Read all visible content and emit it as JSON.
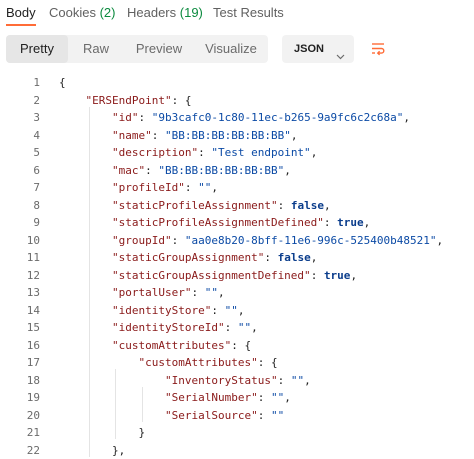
{
  "tabs": [
    {
      "label": "Body",
      "count": ""
    },
    {
      "label": "Cookies",
      "count": "(2)"
    },
    {
      "label": "Headers",
      "count": "(19)"
    },
    {
      "label": "Test Results",
      "count": ""
    }
  ],
  "toolbar": {
    "views": [
      "Pretty",
      "Raw",
      "Preview",
      "Visualize"
    ],
    "active_view": "Pretty",
    "format": "JSON",
    "icons": {
      "chevron": "chevron-down-icon",
      "wrap": "wrap-lines-icon"
    },
    "accent_color": "#ff6c37"
  },
  "code": {
    "colors": {
      "key": "#8a1a1a",
      "string": "#0b4aa5",
      "bool": "#0b3d8c",
      "line_number": "#6b6b6b"
    },
    "lines": [
      {
        "n": "1",
        "indent": 0,
        "tokens": [
          [
            "p",
            "{"
          ]
        ]
      },
      {
        "n": "2",
        "indent": 1,
        "tokens": [
          [
            "k",
            "\"ERSEndPoint\""
          ],
          [
            "p",
            ": {"
          ]
        ]
      },
      {
        "n": "3",
        "indent": 2,
        "tokens": [
          [
            "k",
            "\"id\""
          ],
          [
            "p",
            ": "
          ],
          [
            "s",
            "\"9b3cafc0-1c80-11ec-b265-9a9fc6c2c68a\""
          ],
          [
            "p",
            ","
          ]
        ]
      },
      {
        "n": "4",
        "indent": 2,
        "tokens": [
          [
            "k",
            "\"name\""
          ],
          [
            "p",
            ": "
          ],
          [
            "s",
            "\"BB:BB:BB:BB:BB:BB\""
          ],
          [
            "p",
            ","
          ]
        ]
      },
      {
        "n": "5",
        "indent": 2,
        "tokens": [
          [
            "k",
            "\"description\""
          ],
          [
            "p",
            ": "
          ],
          [
            "s",
            "\"Test endpoint\""
          ],
          [
            "p",
            ","
          ]
        ]
      },
      {
        "n": "6",
        "indent": 2,
        "tokens": [
          [
            "k",
            "\"mac\""
          ],
          [
            "p",
            ": "
          ],
          [
            "s",
            "\"BB:BB:BB:BB:BB:BB\""
          ],
          [
            "p",
            ","
          ]
        ]
      },
      {
        "n": "7",
        "indent": 2,
        "tokens": [
          [
            "k",
            "\"profileId\""
          ],
          [
            "p",
            ": "
          ],
          [
            "s",
            "\"\""
          ],
          [
            "p",
            ","
          ]
        ]
      },
      {
        "n": "8",
        "indent": 2,
        "tokens": [
          [
            "k",
            "\"staticProfileAssignment\""
          ],
          [
            "p",
            ": "
          ],
          [
            "b",
            "false"
          ],
          [
            "p",
            ","
          ]
        ]
      },
      {
        "n": "9",
        "indent": 2,
        "tokens": [
          [
            "k",
            "\"staticProfileAssignmentDefined\""
          ],
          [
            "p",
            ": "
          ],
          [
            "b",
            "true"
          ],
          [
            "p",
            ","
          ]
        ]
      },
      {
        "n": "10",
        "indent": 2,
        "tokens": [
          [
            "k",
            "\"groupId\""
          ],
          [
            "p",
            ": "
          ],
          [
            "s",
            "\"aa0e8b20-8bff-11e6-996c-525400b48521\""
          ],
          [
            "p",
            ","
          ]
        ]
      },
      {
        "n": "11",
        "indent": 2,
        "tokens": [
          [
            "k",
            "\"staticGroupAssignment\""
          ],
          [
            "p",
            ": "
          ],
          [
            "b",
            "false"
          ],
          [
            "p",
            ","
          ]
        ]
      },
      {
        "n": "12",
        "indent": 2,
        "tokens": [
          [
            "k",
            "\"staticGroupAssignmentDefined\""
          ],
          [
            "p",
            ": "
          ],
          [
            "b",
            "true"
          ],
          [
            "p",
            ","
          ]
        ]
      },
      {
        "n": "13",
        "indent": 2,
        "tokens": [
          [
            "k",
            "\"portalUser\""
          ],
          [
            "p",
            ": "
          ],
          [
            "s",
            "\"\""
          ],
          [
            "p",
            ","
          ]
        ]
      },
      {
        "n": "14",
        "indent": 2,
        "tokens": [
          [
            "k",
            "\"identityStore\""
          ],
          [
            "p",
            ": "
          ],
          [
            "s",
            "\"\""
          ],
          [
            "p",
            ","
          ]
        ]
      },
      {
        "n": "15",
        "indent": 2,
        "tokens": [
          [
            "k",
            "\"identityStoreId\""
          ],
          [
            "p",
            ": "
          ],
          [
            "s",
            "\"\""
          ],
          [
            "p",
            ","
          ]
        ]
      },
      {
        "n": "16",
        "indent": 2,
        "tokens": [
          [
            "k",
            "\"customAttributes\""
          ],
          [
            "p",
            ": {"
          ]
        ]
      },
      {
        "n": "17",
        "indent": 3,
        "tokens": [
          [
            "k",
            "\"customAttributes\""
          ],
          [
            "p",
            ": {"
          ]
        ]
      },
      {
        "n": "18",
        "indent": 4,
        "tokens": [
          [
            "k",
            "\"InventoryStatus\""
          ],
          [
            "p",
            ": "
          ],
          [
            "s",
            "\"\""
          ],
          [
            "p",
            ","
          ]
        ]
      },
      {
        "n": "19",
        "indent": 4,
        "tokens": [
          [
            "k",
            "\"SerialNumber\""
          ],
          [
            "p",
            ": "
          ],
          [
            "s",
            "\"\""
          ],
          [
            "p",
            ","
          ]
        ]
      },
      {
        "n": "20",
        "indent": 4,
        "tokens": [
          [
            "k",
            "\"SerialSource\""
          ],
          [
            "p",
            ": "
          ],
          [
            "s",
            "\"\""
          ]
        ]
      },
      {
        "n": "21",
        "indent": 3,
        "tokens": [
          [
            "p",
            "}"
          ]
        ]
      },
      {
        "n": "22",
        "indent": 2,
        "tokens": [
          [
            "p",
            "},"
          ]
        ]
      }
    ]
  }
}
